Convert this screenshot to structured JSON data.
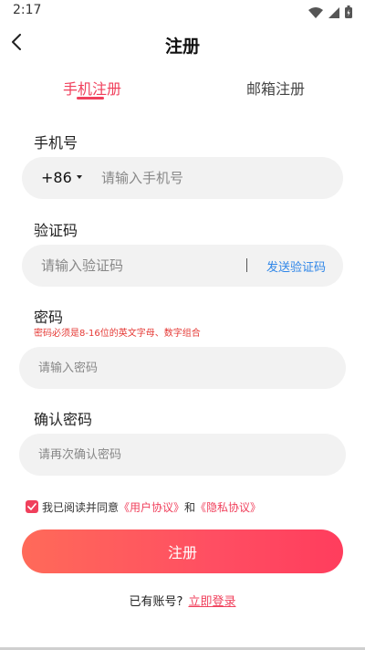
{
  "status": {
    "time": "2:17",
    "icons": [
      "wifi-icon",
      "signal-icon",
      "battery-icon"
    ]
  },
  "header": {
    "title": "注册",
    "back_icon": "chevron-left-icon"
  },
  "tabs": [
    {
      "label": "手机注册",
      "active": true
    },
    {
      "label": "邮箱注册",
      "active": false
    }
  ],
  "form": {
    "phone": {
      "label": "手机号",
      "country_code": "+86",
      "placeholder": "请输入手机号",
      "value": ""
    },
    "code": {
      "label": "验证码",
      "placeholder": "请输入验证码",
      "value": "",
      "send_label": "发送验证码"
    },
    "password": {
      "label": "密码",
      "hint": "密码必须是8-16位的英文字母、数字组合",
      "placeholder": "请输入密码",
      "value": ""
    },
    "confirm": {
      "label": "确认密码",
      "placeholder": "请再次确认密码",
      "value": ""
    }
  },
  "agreement": {
    "checked": true,
    "prefix": "我已阅读并同意",
    "user_agreement": "《用户协议》",
    "connector": "和",
    "privacy_policy": "《隐私协议》"
  },
  "submit_label": "注册",
  "login": {
    "prompt": "已有账号?",
    "link": "立即登录"
  },
  "colors": {
    "accent": "#f0405c",
    "link_blue": "#2f86e8",
    "error": "#e53935",
    "input_bg": "#f2f2f2"
  }
}
